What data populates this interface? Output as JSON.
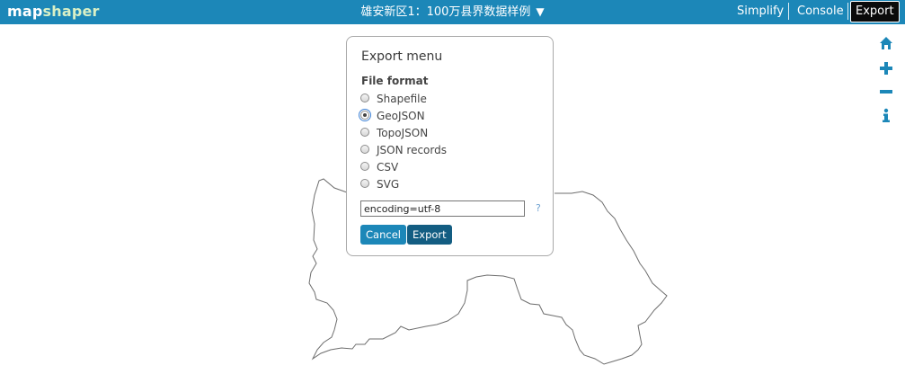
{
  "app": {
    "logo_part1": "map",
    "logo_part2": "shaper",
    "layer_name": "雄安新区1：100万县界数据样例",
    "layer_caret": "▼"
  },
  "menu": {
    "simplify": "Simplify",
    "console": "Console",
    "export": "Export"
  },
  "tools": [
    "home-icon",
    "zoom-in-icon",
    "zoom-out-icon",
    "info-icon"
  ],
  "dialog": {
    "title": "Export menu",
    "format_label": "File format",
    "formats": [
      "Shapefile",
      "GeoJSON",
      "TopoJSON",
      "JSON records",
      "CSV",
      "SVG"
    ],
    "selected_format": "GeoJSON",
    "options_value": "encoding=utf-8",
    "help": "?",
    "cancel_label": "Cancel",
    "export_label": "Export"
  },
  "colors": {
    "topbar": "#1c87b8",
    "export_active": "#0b0b0b",
    "map_stroke": "#6e6e6e"
  }
}
